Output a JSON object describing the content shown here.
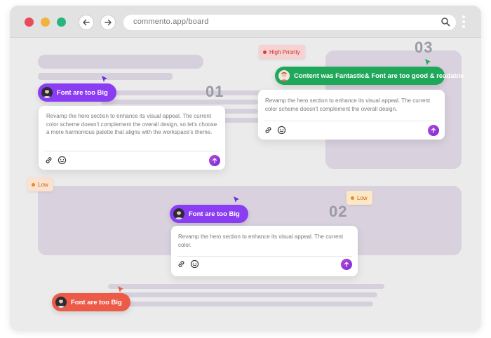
{
  "browser": {
    "url": "commento.app/board",
    "traffic_lights": {
      "close": "#e84b5a",
      "minimize": "#f2b33d",
      "maximize": "#27b47e"
    },
    "back_icon": "arrow-left-icon",
    "forward_icon": "arrow-right-icon",
    "search_icon": "search-icon",
    "menu_icon": "kebab-icon"
  },
  "board": {
    "numbers": {
      "n1": "01",
      "n2": "02",
      "n3": "03"
    },
    "tags": {
      "high": {
        "label": "High Priority",
        "color": "#e23b3b",
        "bg": "#f6d2d2"
      },
      "low_left": {
        "label": "Low",
        "color": "#e88a2a",
        "bg": "#fbe1cf"
      },
      "low_right": {
        "label": "Low",
        "color": "#e88a2a",
        "bg": "#fde8c6"
      }
    },
    "pills": {
      "p1": {
        "label": "Font are too Big",
        "color": "#8a3df2"
      },
      "p2": {
        "label": "Content was Fantastic& Font are too good & readable",
        "color": "#1fa75a"
      },
      "p3": {
        "label": "Font are too Big",
        "color": "#8a3df2"
      },
      "p4": {
        "label": "Font are too Big",
        "color": "#ec5a48"
      }
    },
    "cards": {
      "c1": {
        "text": "Revamp the hero section to enhance its visual appeal. The current color scheme doesn't complement the overall design, so let's choose a more harmonious palette that aligns with the workspace's theme."
      },
      "c2": {
        "text": "Revamp the hero section to enhance its visual appeal. The current color scheme doesn't complement the overall design."
      },
      "c3": {
        "text": "Revamp the hero section to enhance its visual appeal. The current color."
      }
    }
  }
}
